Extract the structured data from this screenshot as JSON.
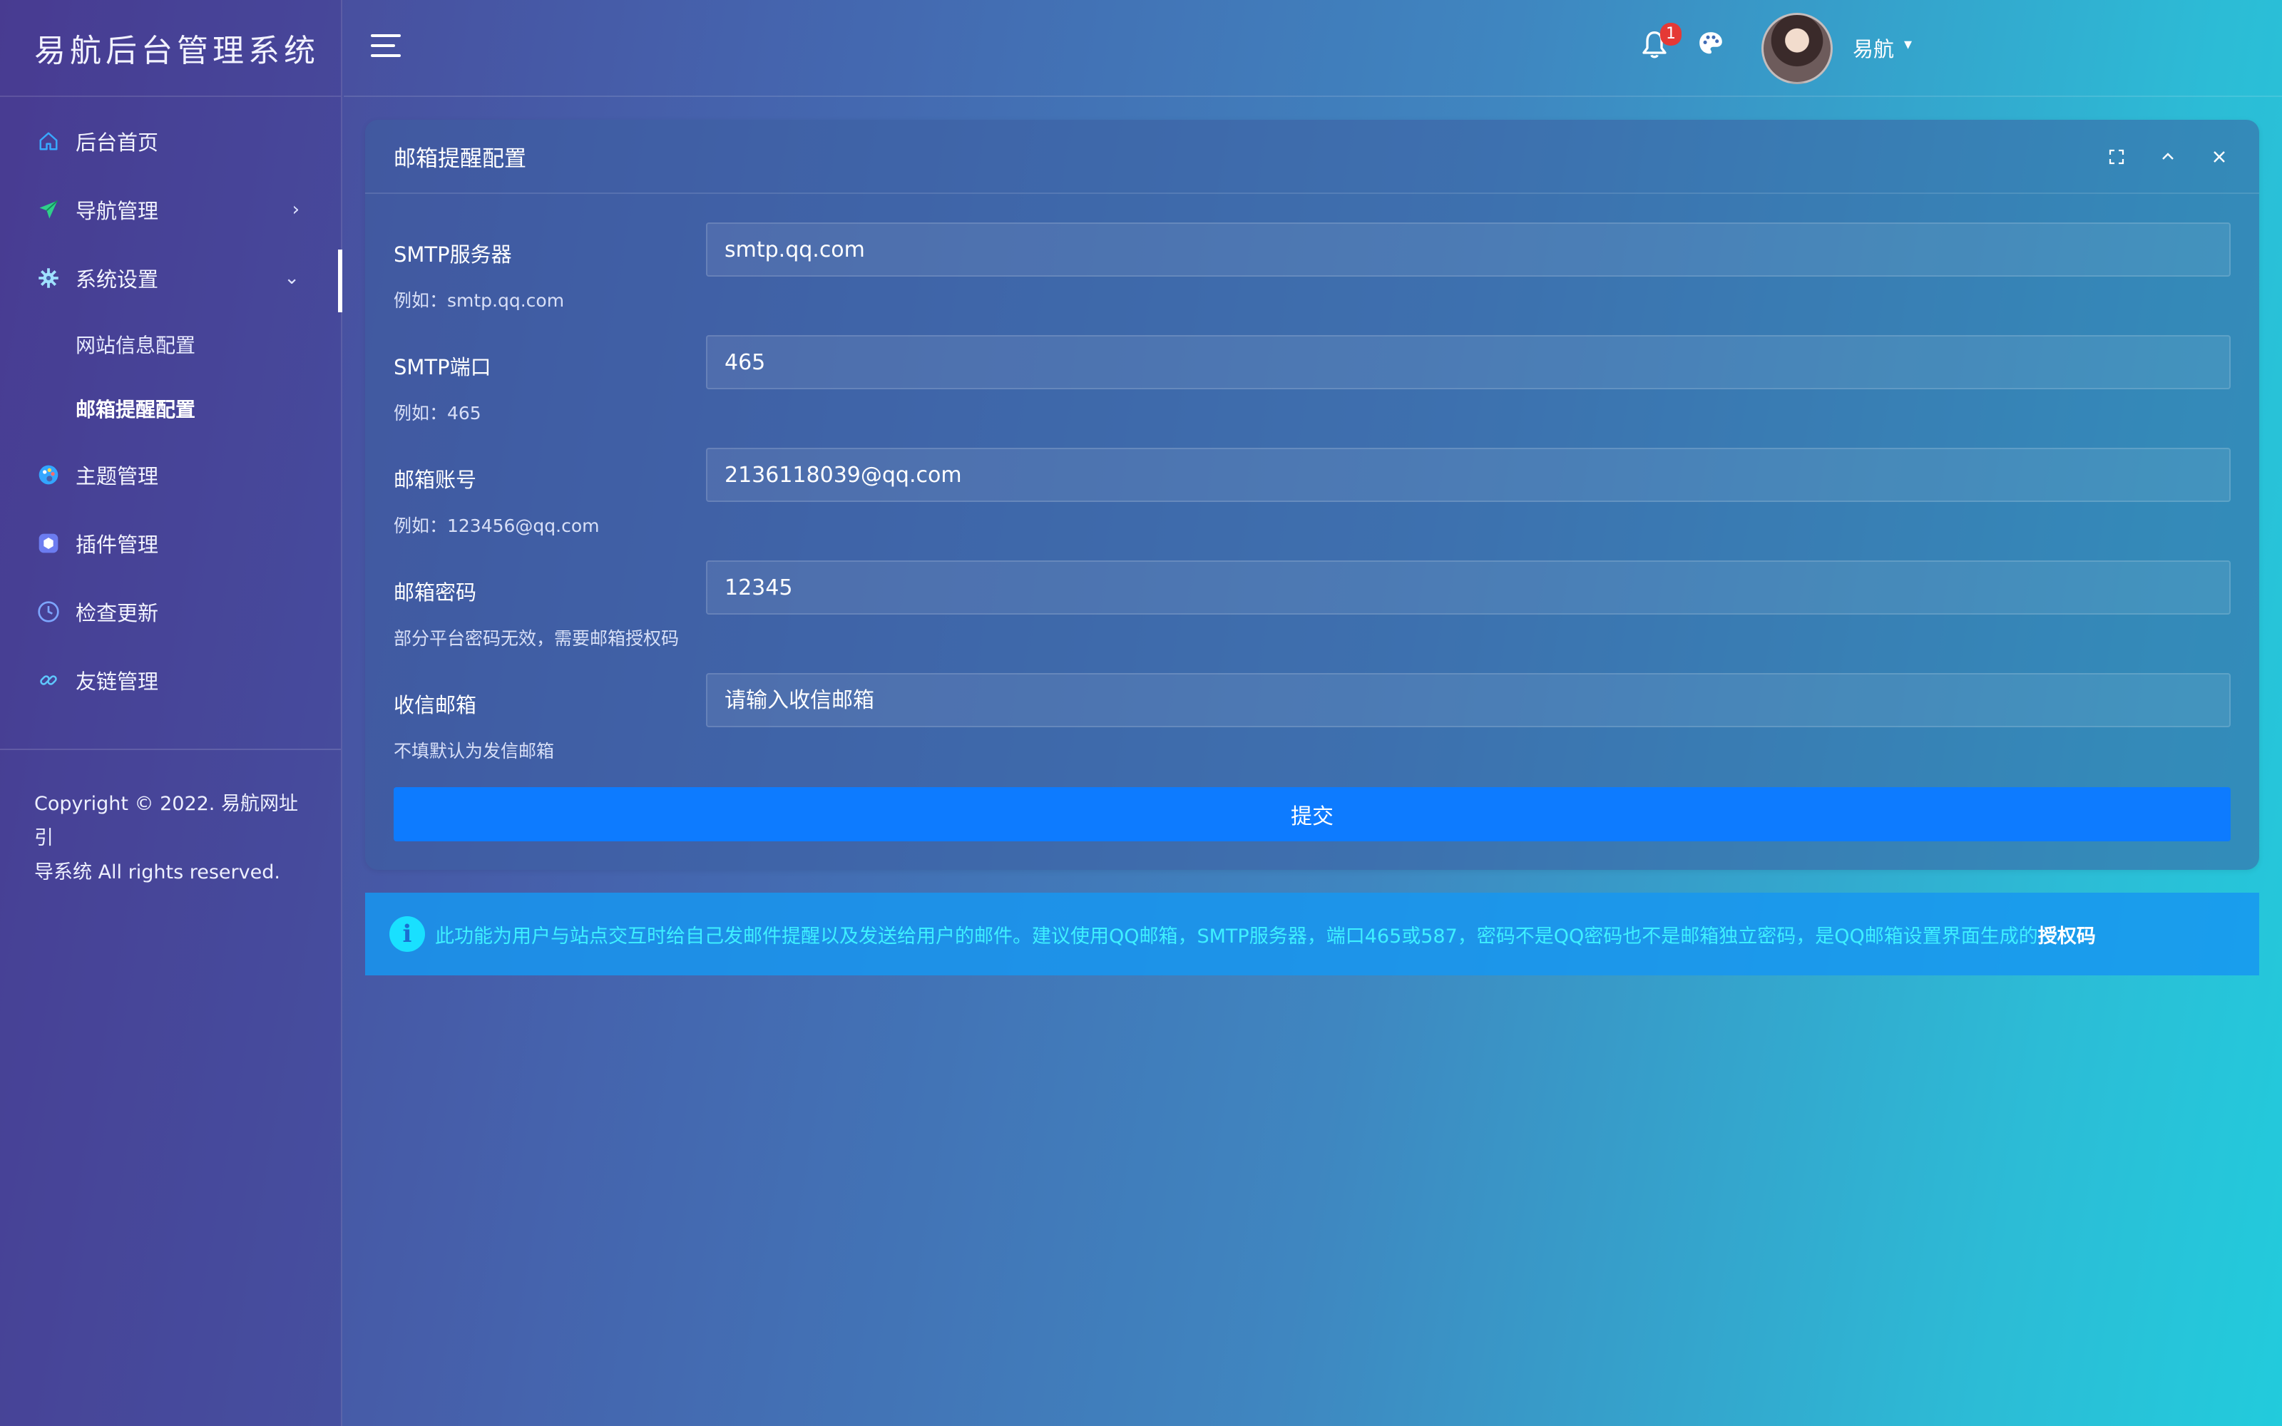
{
  "app": {
    "logo_text": "易航后台管理系统"
  },
  "sidebar": {
    "items": [
      {
        "label": "后台首页",
        "icon": "home-icon"
      },
      {
        "label": "导航管理",
        "icon": "send-icon",
        "arrow": "›"
      },
      {
        "label": "系统设置",
        "icon": "gear-icon",
        "arrow": "⌄",
        "expanded": true,
        "children": [
          {
            "label": "网站信息配置"
          },
          {
            "label": "邮箱提醒配置",
            "active": true
          }
        ]
      },
      {
        "label": "主题管理",
        "icon": "palette-icon"
      },
      {
        "label": "插件管理",
        "icon": "plugin-icon"
      },
      {
        "label": "检查更新",
        "icon": "clock-icon"
      },
      {
        "label": "友链管理",
        "icon": "link-icon"
      }
    ],
    "copyright_line1": "Copyright © 2022. 易航网址引",
    "copyright_line2": "导系统 All rights reserved."
  },
  "header": {
    "notification_count": "1",
    "username": "易航"
  },
  "card": {
    "title": "邮箱提醒配置",
    "fields": [
      {
        "label": "SMTP服务器",
        "value": "smtp.qq.com",
        "placeholder": "",
        "help": "例如：smtp.qq.com"
      },
      {
        "label": "SMTP端口",
        "value": "465",
        "placeholder": "",
        "help": "例如：465"
      },
      {
        "label": "邮箱账号",
        "value": "2136118039@qq.com",
        "placeholder": "",
        "help": "例如：123456@qq.com"
      },
      {
        "label": "邮箱密码",
        "value": "12345",
        "placeholder": "",
        "help": "部分平台密码无效，需要邮箱授权码"
      },
      {
        "label": "收信邮箱",
        "value": "",
        "placeholder": "请输入收信邮箱",
        "help": "不填默认为发信邮箱"
      }
    ],
    "submit_label": "提交"
  },
  "alert": {
    "icon": "info-icon",
    "text": "此功能为用户与站点交互时给自己发邮件提醒以及发送给用户的邮件。建议使用QQ邮箱，SMTP服务器，端口465或587，密码不是QQ密码也不是邮箱独立密码，是QQ邮箱设置界面生成的",
    "strong": "授权码"
  },
  "colors": {
    "primary_button": "#0d7bff",
    "alert_bg": "#1896f0",
    "alert_text": "#3ff0ff",
    "badge": "#e53935"
  }
}
